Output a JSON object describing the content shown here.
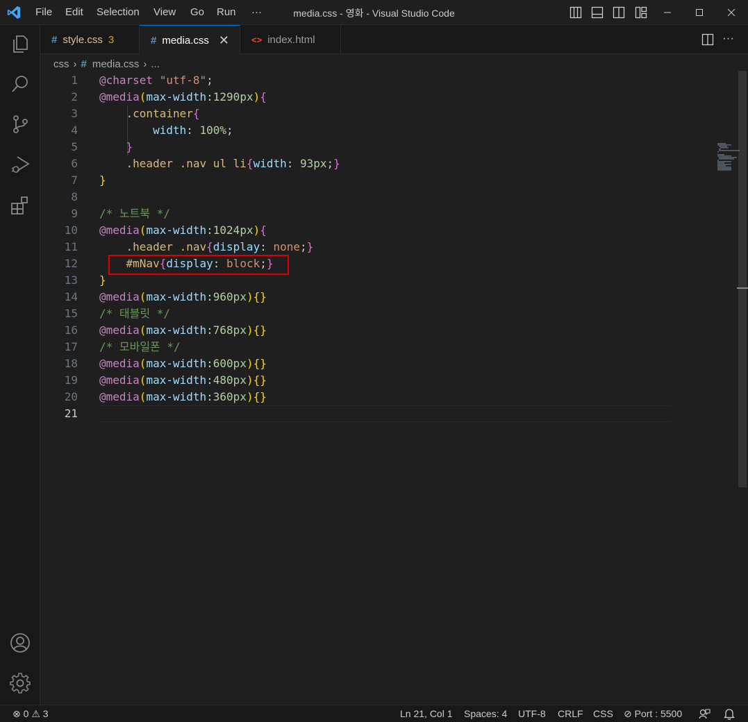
{
  "titlebar": {
    "menu": [
      "File",
      "Edit",
      "Selection",
      "View",
      "Go",
      "Run",
      "···"
    ],
    "title": "media.css - 영화 - Visual Studio Code"
  },
  "tabs": [
    {
      "label": "style.css",
      "icon": "#",
      "badge": "3",
      "color": "#e2c08d",
      "active": false
    },
    {
      "label": "media.css",
      "icon": "#",
      "badge": "",
      "color": "#ffffff",
      "active": true
    },
    {
      "label": "index.html",
      "icon": "<>",
      "badge": "",
      "color": "#9d9d9d",
      "active": false
    }
  ],
  "breadcrumb": {
    "folder": "css",
    "icon": "#",
    "file": "media.css",
    "more": "..."
  },
  "editor": {
    "current_line": 21,
    "lines": [
      {
        "n": "1"
      },
      {
        "n": "2"
      },
      {
        "n": "3"
      },
      {
        "n": "4"
      },
      {
        "n": "5"
      },
      {
        "n": "6"
      },
      {
        "n": "7"
      },
      {
        "n": "8"
      },
      {
        "n": "9"
      },
      {
        "n": "10"
      },
      {
        "n": "11"
      },
      {
        "n": "12"
      },
      {
        "n": "13"
      },
      {
        "n": "14"
      },
      {
        "n": "15"
      },
      {
        "n": "16"
      },
      {
        "n": "17"
      },
      {
        "n": "18"
      },
      {
        "n": "19"
      },
      {
        "n": "20"
      },
      {
        "n": "21"
      }
    ],
    "tokens": {
      "l1": [
        "@charset",
        " ",
        "\"utf-8\"",
        ";"
      ],
      "l2": [
        "@media",
        "(",
        "max-width",
        ":",
        "1290px",
        ")",
        "{"
      ],
      "l3": [
        "    .container",
        "{"
      ],
      "l4": [
        "        width",
        ": ",
        "100%",
        ";"
      ],
      "l5": [
        "    ",
        "}"
      ],
      "l6": [
        "    .header .nav ul li",
        "{",
        "width",
        ": ",
        "93px",
        ";",
        "}"
      ],
      "l7": [
        "}"
      ],
      "l9": [
        "/* 노트북 */"
      ],
      "l10": [
        "@media",
        "(",
        "max-width",
        ":",
        "1024px",
        ")",
        "{"
      ],
      "l11": [
        "    .header .nav",
        "{",
        "display",
        ": ",
        "none",
        ";",
        "}"
      ],
      "l12": [
        "    #mNav",
        "{",
        "display",
        ": ",
        "block",
        ";",
        "}"
      ],
      "l13": [
        "}"
      ],
      "l14": [
        "@media",
        "(",
        "max-width",
        ":",
        "960px",
        ")",
        "{}"
      ],
      "l15": [
        "/* 태블릿 */"
      ],
      "l16": [
        "@media",
        "(",
        "max-width",
        ":",
        "768px",
        ")",
        "{}"
      ],
      "l17": [
        "/* 모바일폰 */"
      ],
      "l18": [
        "@media",
        "(",
        "max-width",
        ":",
        "600px",
        ")",
        "{}"
      ],
      "l19": [
        "@media",
        "(",
        "max-width",
        ":",
        "480px",
        ")",
        "{}"
      ],
      "l20": [
        "@media",
        "(",
        "max-width",
        ":",
        "360px",
        ")",
        "{}"
      ]
    }
  },
  "statusbar": {
    "errors": "0",
    "warnings": "3",
    "position": "Ln 21, Col 1",
    "spaces": "Spaces: 4",
    "encoding": "UTF-8",
    "eol": "CRLF",
    "language": "CSS",
    "port": "Port : 5500"
  },
  "colors": {
    "accent": "#0078d4",
    "highlight_box": "#e00000",
    "background": "#1f1f1f"
  }
}
